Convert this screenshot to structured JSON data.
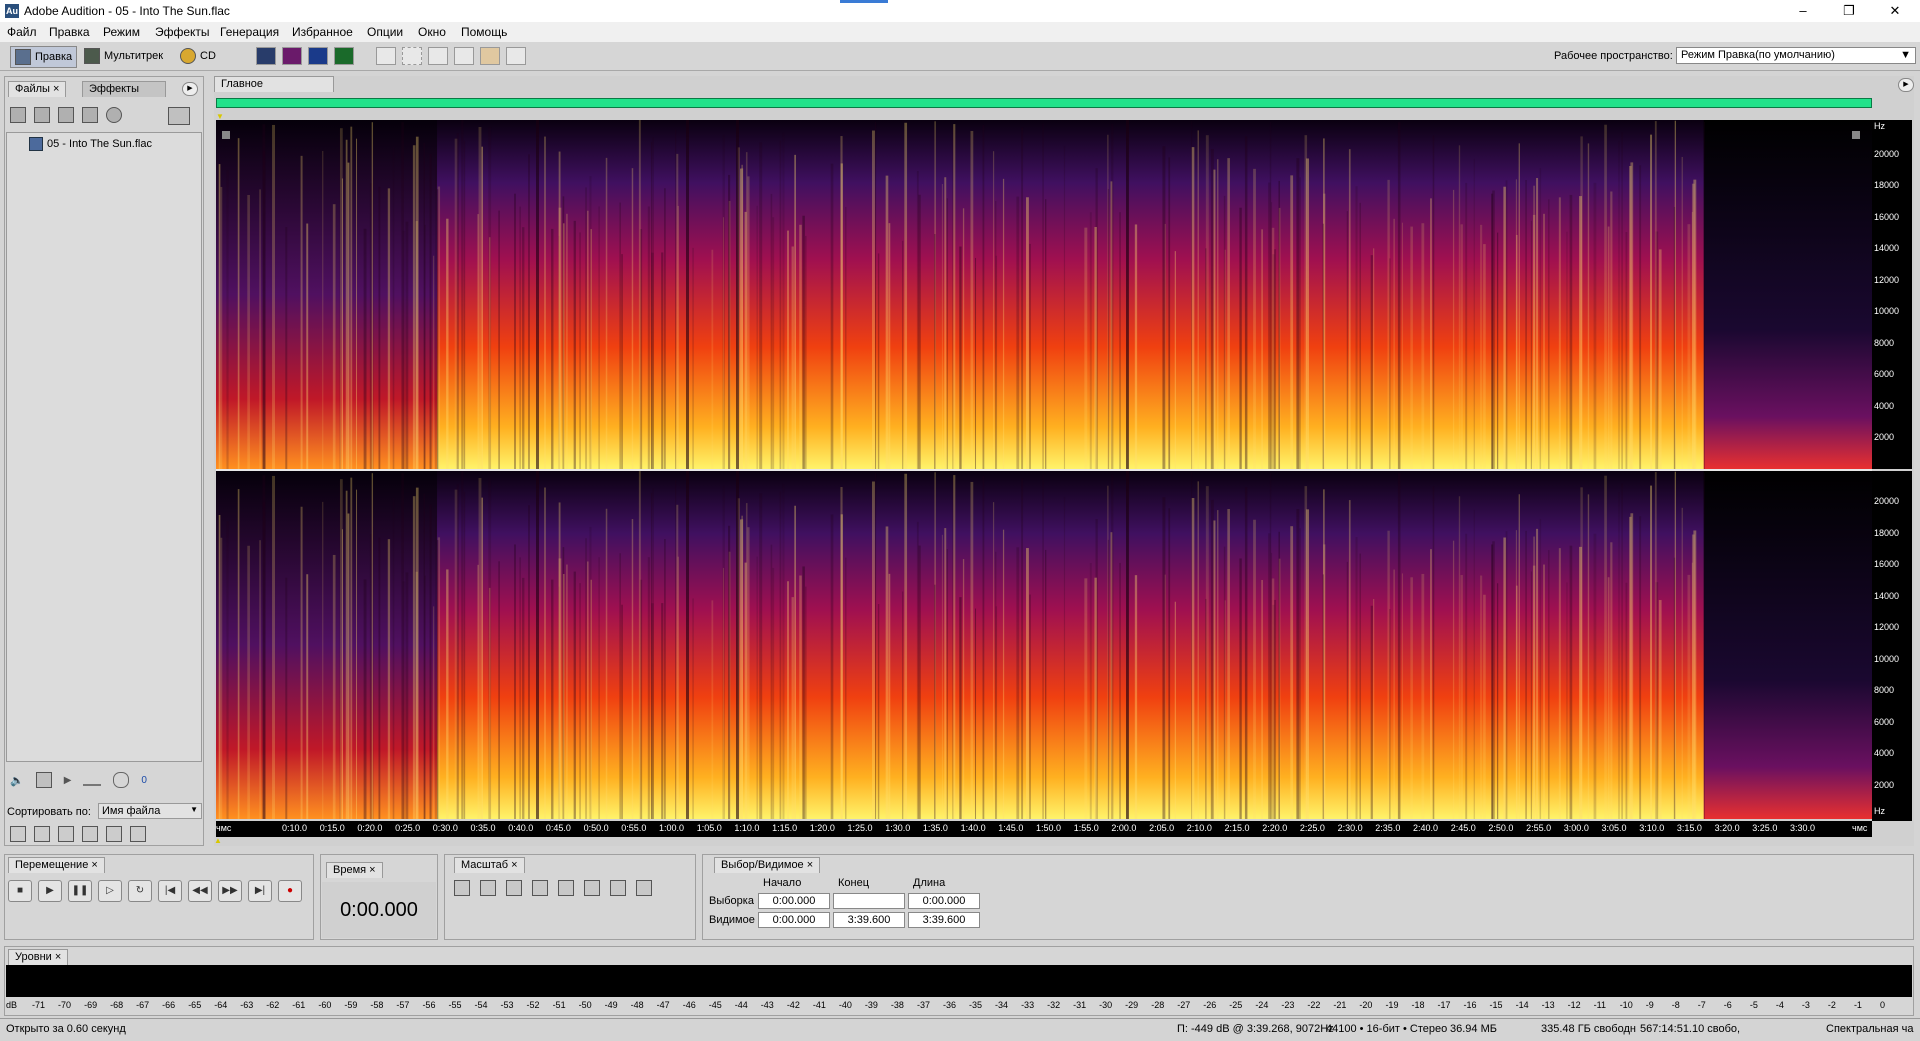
{
  "window": {
    "title": "Adobe Audition - 05 - Into The Sun.flac",
    "app_icon": "Au"
  },
  "menu": [
    "Файл",
    "Правка",
    "Режим",
    "Эффекты",
    "Генерация",
    "Избранное",
    "Опции",
    "Окно",
    "Помощь"
  ],
  "toolbar": {
    "modes": [
      {
        "label": "Правка",
        "icon": "edit-view-icon"
      },
      {
        "label": "Мультитрек",
        "icon": "multitrack-icon"
      },
      {
        "label": "CD",
        "icon": "cd-icon"
      }
    ],
    "workspace_label": "Рабочее пространство:",
    "workspace_value": "Режим Правка(по умолчанию)"
  },
  "files_panel": {
    "tabs": [
      "Файлы",
      "Эффекты"
    ],
    "items": [
      "05 - Into The Sun.flac"
    ],
    "sort_label": "Сортировать по:",
    "sort_value": "Имя файла",
    "volume_value": "0"
  },
  "editor": {
    "tab": "Главное",
    "freq_labels": [
      "Hz",
      "20000",
      "18000",
      "16000",
      "14000",
      "12000",
      "10000",
      "8000",
      "6000",
      "4000",
      "2000"
    ],
    "freq_labels2": [
      "20000",
      "18000",
      "16000",
      "14000",
      "12000",
      "10000",
      "8000",
      "6000",
      "4000",
      "2000",
      "Hz"
    ],
    "time_labels": [
      "чмс",
      "0:10.0",
      "0:15.0",
      "0:20.0",
      "0:25.0",
      "0:30.0",
      "0:35.0",
      "0:40.0",
      "0:45.0",
      "0:50.0",
      "0:55.0",
      "1:00.0",
      "1:05.0",
      "1:10.0",
      "1:15.0",
      "1:20.0",
      "1:25.0",
      "1:30.0",
      "1:35.0",
      "1:40.0",
      "1:45.0",
      "1:50.0",
      "1:55.0",
      "2:00.0",
      "2:05.0",
      "2:10.0",
      "2:15.0",
      "2:20.0",
      "2:25.0",
      "2:30.0",
      "2:35.0",
      "2:40.0",
      "2:45.0",
      "2:50.0",
      "2:55.0",
      "3:00.0",
      "3:05.0",
      "3:10.0",
      "3:15.0",
      "3:20.0",
      "3:25.0",
      "3:30.0",
      "чмс"
    ]
  },
  "transport": {
    "tab": "Перемещение"
  },
  "time_panel": {
    "tab": "Время",
    "value": "0:00.000"
  },
  "zoom_panel": {
    "tab": "Масштаб"
  },
  "selection_panel": {
    "tab": "Выбор/Видимое",
    "headers": [
      "Начало",
      "Конец",
      "Длина"
    ],
    "rows": [
      {
        "label": "Выборка",
        "start": "0:00.000",
        "end": "",
        "length": "0:00.000"
      },
      {
        "label": "Видимое",
        "start": "0:00.000",
        "end": "3:39.600",
        "length": "3:39.600"
      }
    ]
  },
  "levels": {
    "tab": "Уровни",
    "db_labels": [
      "dB",
      "-71",
      "-70",
      "-69",
      "-68",
      "-67",
      "-66",
      "-65",
      "-64",
      "-63",
      "-62",
      "-61",
      "-60",
      "-59",
      "-58",
      "-57",
      "-56",
      "-55",
      "-54",
      "-53",
      "-52",
      "-51",
      "-50",
      "-49",
      "-48",
      "-47",
      "-46",
      "-45",
      "-44",
      "-43",
      "-42",
      "-41",
      "-40",
      "-39",
      "-38",
      "-37",
      "-36",
      "-35",
      "-34",
      "-33",
      "-32",
      "-31",
      "-30",
      "-29",
      "-28",
      "-27",
      "-26",
      "-25",
      "-24",
      "-23",
      "-22",
      "-21",
      "-20",
      "-19",
      "-18",
      "-17",
      "-16",
      "-15",
      "-14",
      "-13",
      "-12",
      "-11",
      "-10",
      "-9",
      "-8",
      "-7",
      "-6",
      "-5",
      "-4",
      "-3",
      "-2",
      "-1",
      "0"
    ]
  },
  "status": {
    "open_time": "Открыто за 0.60 секунд",
    "cursor": "П: -449 dB @  3:39.268, 9072Hz",
    "format": "44100 • 16-бит • Стерео",
    "size": "36.94 МБ",
    "disk": "335.48 ГБ свободн",
    "free_time": "567:14:51.10 свобо,",
    "view_mode": "Спектральная ча"
  }
}
